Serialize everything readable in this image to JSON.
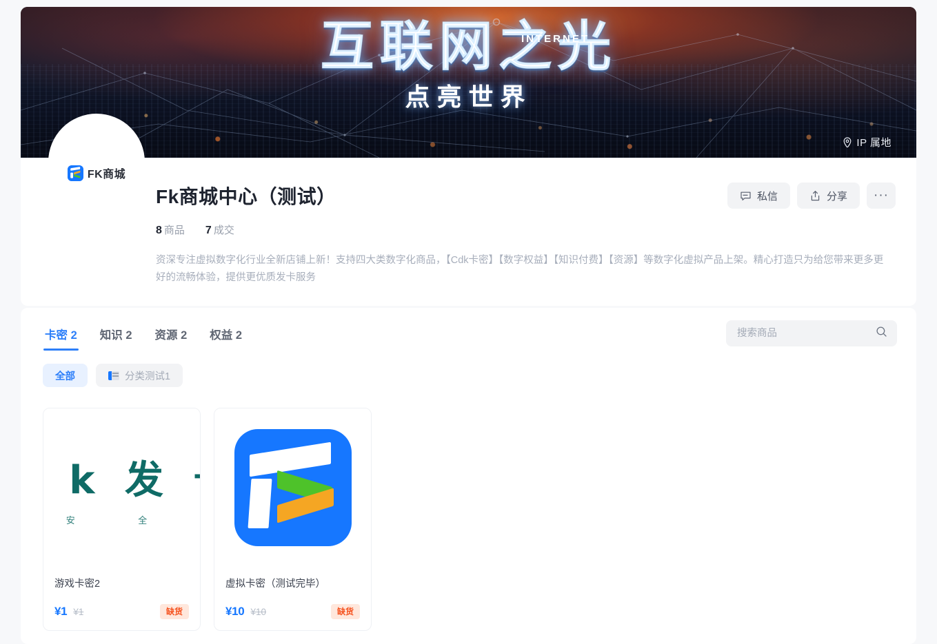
{
  "banner": {
    "headline_main": "互联网之光",
    "headline_sub": "点亮世界",
    "headline_english": "INTERNET",
    "ip_label": "IP 属地"
  },
  "shop": {
    "avatar_text": "FK商城",
    "title": "Fk商城中心（测试）",
    "stats": [
      {
        "value": "8",
        "label": "商品"
      },
      {
        "value": "7",
        "label": "成交"
      }
    ],
    "description": "资深专注虚拟数字化行业全新店铺上新！支持四大类数字化商品，【Cdk卡密】【数字权益】【知识付费】【资源】等数字化虚拟产品上架。精心打造只为给您带来更多更好的流畅体验，提供更优质发卡服务",
    "actions": {
      "message": "私信",
      "share": "分享",
      "more": "···"
    }
  },
  "products_panel": {
    "tabs": [
      {
        "label": "卡密 2",
        "active": true
      },
      {
        "label": "知识 2",
        "active": false
      },
      {
        "label": "资源 2",
        "active": false
      },
      {
        "label": "权益 2",
        "active": false
      }
    ],
    "search": {
      "value": "",
      "placeholder": "搜索商品"
    },
    "chips": [
      {
        "label": "全部",
        "active": true,
        "has_icon": false
      },
      {
        "label": "分类测试1",
        "active": false,
        "has_icon": true
      }
    ],
    "items": [
      {
        "name": "游戏卡密2",
        "price": "¥1",
        "original_price": "¥1",
        "badge": "缺货",
        "thumb": "fk-wordmark-teal",
        "thumb_line1": "F k 发 卡",
        "thumb_line2": "注 安 全 效"
      },
      {
        "name": "虚拟卡密（测试完毕）",
        "price": "¥10",
        "original_price": "¥10",
        "badge": "缺货",
        "thumb": "fk-logo-blue"
      }
    ]
  },
  "colors": {
    "accent_blue": "#2d7ff9",
    "price_blue": "#1677ff",
    "badge_bg": "#ffe7dc",
    "badge_text": "#f5521f",
    "page_bg": "#f7f8fa",
    "chip_active_bg": "#e8f1ff"
  }
}
